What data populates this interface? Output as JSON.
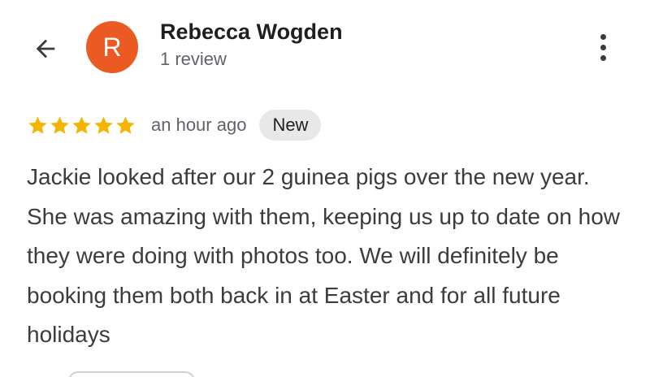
{
  "header": {
    "back_icon": "arrow-left-icon",
    "avatar_letter": "R",
    "avatar_color": "#ec5a24",
    "reviewer_name": "Rebecca Wogden",
    "review_count": "1 review",
    "more_icon": "more-vert-icon"
  },
  "review": {
    "rating": 5,
    "star_color": "#f4b400",
    "time_ago": "an hour ago",
    "badge": "New",
    "text": "Jackie looked after our 2 guinea pigs over the new year. She was amazing with them, keeping us up to date on how they were doing with photos too. We will definitely be booking them both back in at Easter and for all future holidays"
  }
}
